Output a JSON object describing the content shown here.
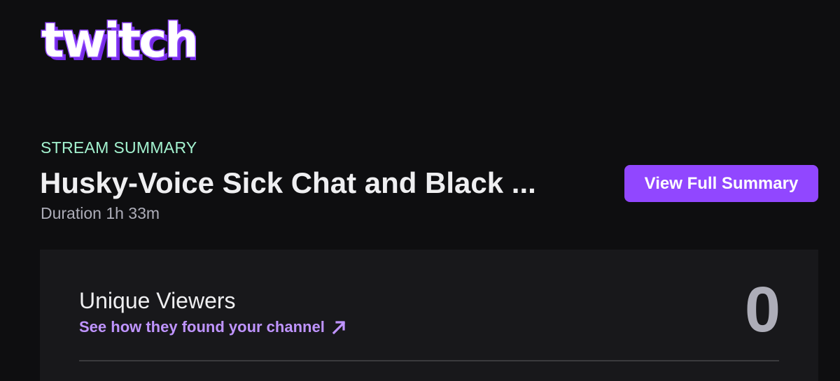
{
  "brand": {
    "logo_text": "twitch",
    "accent_color": "#9147ff"
  },
  "summary": {
    "kicker": "STREAM SUMMARY",
    "title": "Husky-Voice Sick Chat and Black ...",
    "duration": "Duration 1h 33m",
    "view_full_button": "View Full Summary"
  },
  "metrics": [
    {
      "label": "Unique Viewers",
      "link_text": "See how they found your channel",
      "link_icon": "arrow-up-right-icon",
      "value": "0"
    }
  ]
}
